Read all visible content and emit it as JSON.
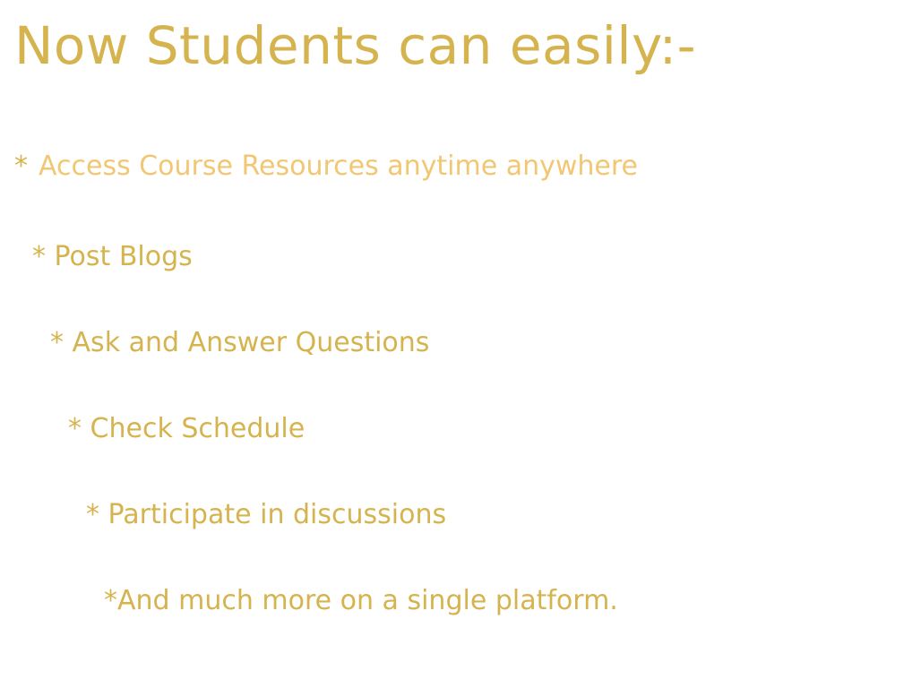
{
  "slide": {
    "title": "Now Students can easily:-",
    "bullets": [
      {
        "marker": "*",
        "text": "Access Course Resources anytime anywhere"
      },
      {
        "marker": "*",
        "text": " Post Blogs"
      },
      {
        "marker": "*",
        "text": " Ask and Answer Questions"
      },
      {
        "marker": "*",
        "text": " Check Schedule"
      },
      {
        "marker": "*",
        "text": " Participate in discussions"
      },
      {
        "marker": "*",
        "text": "And much more on a single platform."
      }
    ]
  },
  "colors": {
    "title": "#d5b44f",
    "bullet_text": "#d5b44f",
    "highlight_text": "#f2c773",
    "background": "#ffffff"
  }
}
